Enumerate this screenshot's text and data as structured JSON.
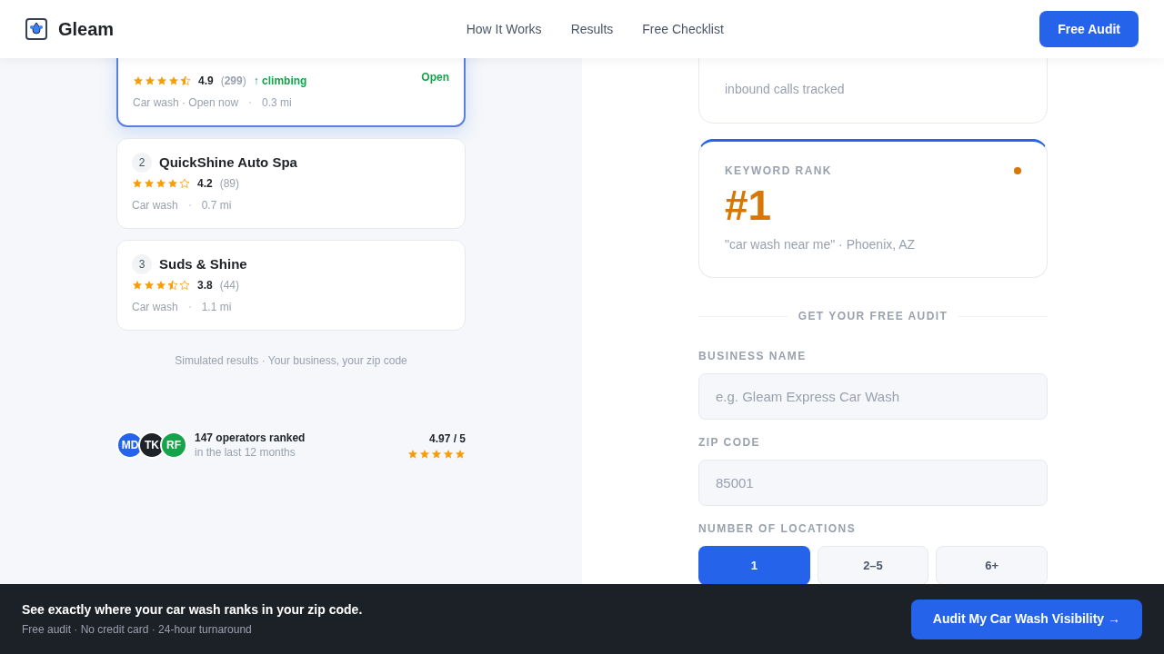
{
  "header": {
    "brand": "Gleam",
    "nav": [
      "How It Works",
      "Results",
      "Free Checklist"
    ],
    "cta": "Free Audit"
  },
  "listings": [
    {
      "selected": true,
      "stars": 4.5,
      "rating": "4.9",
      "reviews": "(**299**)",
      "trend": "↑ climbing",
      "status": "Open",
      "meta": "Car wash · Open now",
      "distance": "0.3 mi"
    },
    {
      "selected": false,
      "rank": "2",
      "name": "QuickShine Auto Spa",
      "stars": 4,
      "rating": "4.2",
      "reviews": "(89)",
      "meta": "Car wash",
      "distance": "0.7 mi"
    },
    {
      "selected": false,
      "rank": "3",
      "name": "Suds & Shine",
      "stars": 3.5,
      "rating": "3.8",
      "reviews": "(44)",
      "meta": "Car wash",
      "distance": "1.1 mi"
    }
  ],
  "caption": "Simulated results · Your business, your zip code",
  "social_proof": {
    "avatars": [
      {
        "initials": "MD",
        "color": "#2563eb"
      },
      {
        "initials": "TK",
        "color": "#1f2328"
      },
      {
        "initials": "RF",
        "color": "#16a34a"
      }
    ],
    "title": "147 operators ranked",
    "subtitle": "in the last 12 months",
    "score": "4.97 / 5",
    "stars": 5
  },
  "stat_cards": [
    {
      "caption": "inbound calls tracked"
    },
    {
      "label": "KEYWORD RANK",
      "value": "#1",
      "caption": "\"car wash near me\" · Phoenix, AZ",
      "color": "#d97706"
    }
  ],
  "form": {
    "heading": "GET YOUR FREE AUDIT",
    "fields": [
      {
        "label": "BUSINESS NAME",
        "placeholder": "e.g. Gleam Express Car Wash"
      },
      {
        "label": "ZIP CODE",
        "placeholder": "85001"
      }
    ],
    "locations_label": "NUMBER OF LOCATIONS",
    "locations": [
      {
        "label": "1",
        "selected": true
      },
      {
        "label": "2–5",
        "selected": false
      },
      {
        "label": "6+",
        "selected": false
      }
    ]
  },
  "bottom_bar": {
    "title": "See exactly where your car wash ranks in your zip code.",
    "subtitle": "Free audit · No credit card · 24-hour turnaround",
    "cta": "Audit My Car Wash Visibility →"
  }
}
